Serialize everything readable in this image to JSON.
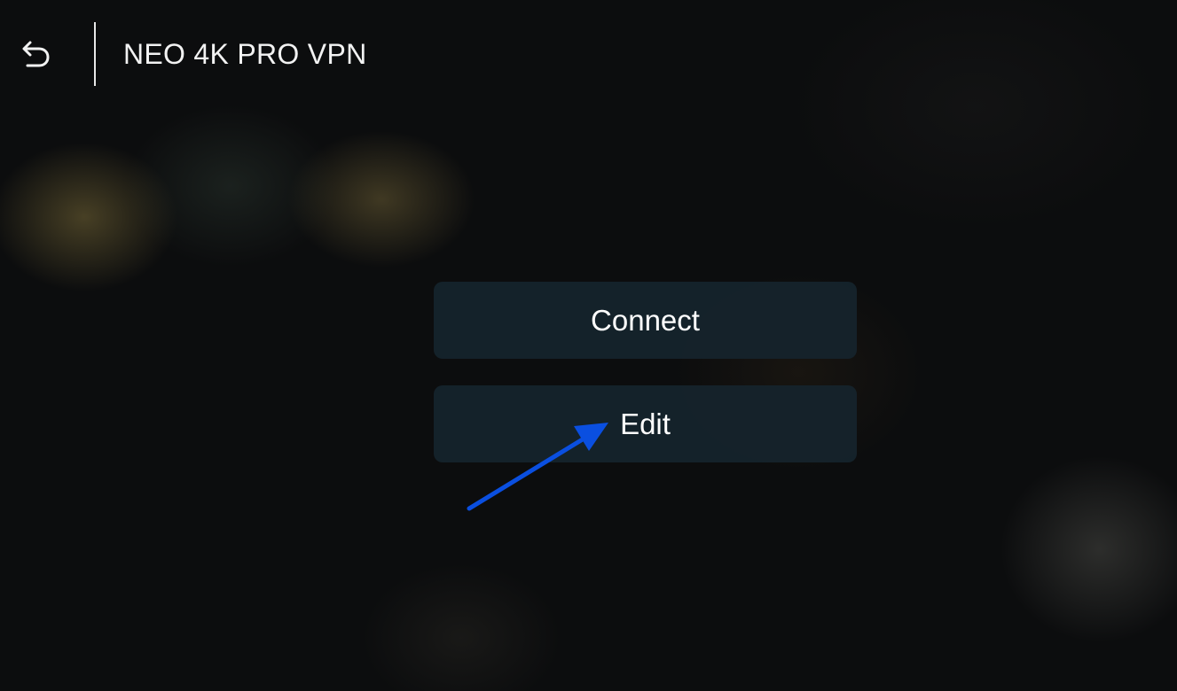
{
  "header": {
    "back_icon": "back-arrow-icon",
    "title": "NEO 4K PRO VPN"
  },
  "menu": {
    "items": [
      {
        "label": "Connect"
      },
      {
        "label": "Edit"
      }
    ]
  },
  "annotation": {
    "arrow_color": "#0a4fe0",
    "points_to": "Edit"
  },
  "colors": {
    "background": "#0c0d0e",
    "button_bg": "#16242c",
    "text": "#ffffff"
  }
}
